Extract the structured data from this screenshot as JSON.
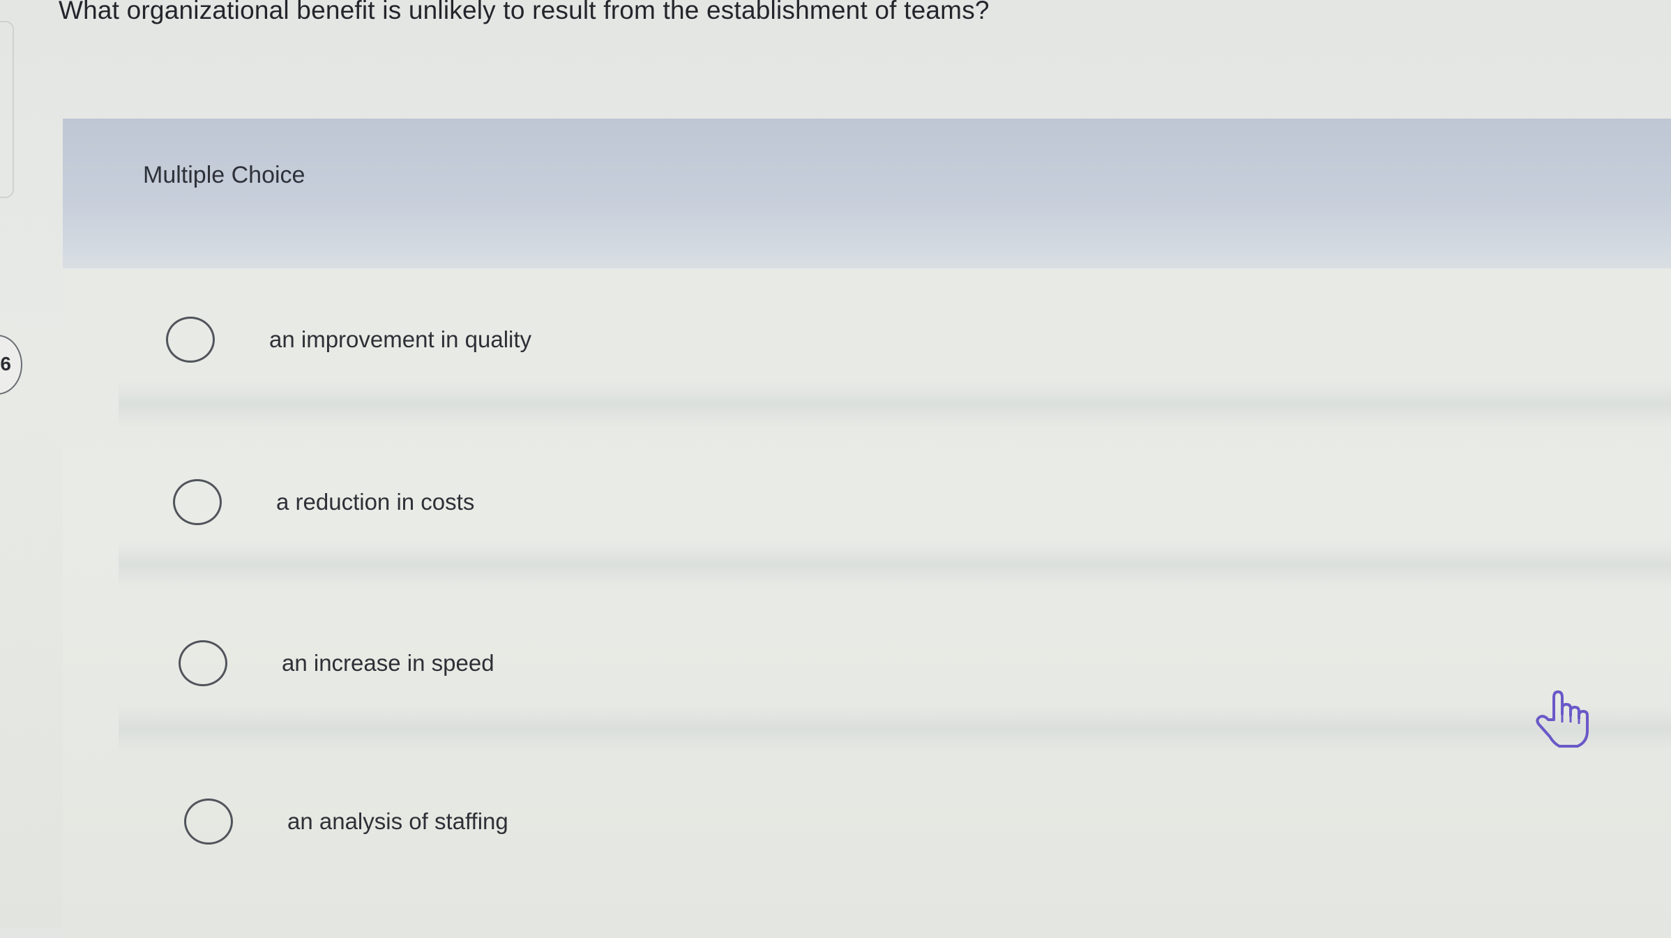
{
  "question": {
    "text": "What organizational benefit is unlikely to result from the establishment of teams?"
  },
  "question_number": "6",
  "panel": {
    "type_label": "Multiple Choice"
  },
  "options": [
    {
      "label": "an improvement in quality",
      "selected": false
    },
    {
      "label": "a reduction in costs",
      "selected": false
    },
    {
      "label": "an increase in speed",
      "selected": false
    },
    {
      "label": "an analysis of staffing",
      "selected": false
    }
  ],
  "colors": {
    "header_band": "#c3cbd8",
    "cursor": "#6a58c8"
  },
  "icons": {
    "pointer": "hand-pointer-icon"
  }
}
